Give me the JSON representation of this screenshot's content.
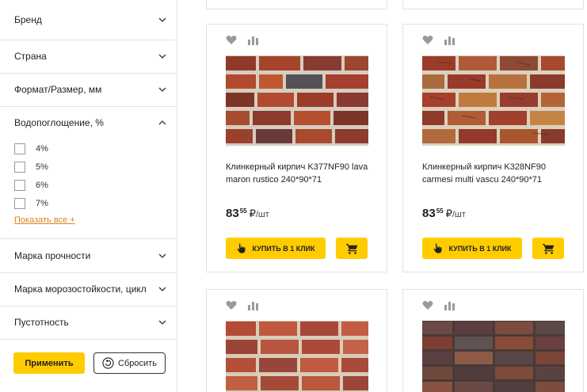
{
  "filters": {
    "sections": [
      {
        "title": "Бренд",
        "icon": "chevron-down-icon"
      },
      {
        "title": "Страна",
        "icon": "chevron-down-icon"
      },
      {
        "title": "Формат/Размер, мм",
        "icon": "chevron-down-icon"
      },
      {
        "title": "Водопоглощение, %",
        "icon": "chevron-up-icon"
      },
      {
        "title": "Марка прочности",
        "icon": "chevron-down-icon"
      },
      {
        "title": "Марка морозостойкости, цикл",
        "icon": "chevron-down-icon"
      },
      {
        "title": "Пустотность",
        "icon": "chevron-down-icon"
      }
    ],
    "water_absorption_options": [
      "4%",
      "5%",
      "6%",
      "7%"
    ],
    "show_all": "Показать все +",
    "apply_label": "Применить",
    "reset_label": "Сбросить"
  },
  "products": [
    {
      "title": "Клинкерный кирпич K377NF90 lava maron rustico 240*90*71",
      "price_int": "83",
      "price_dec": "55",
      "currency": "₽",
      "unit": "/шт",
      "buy_label": "КУПИТЬ В 1 КЛИК"
    },
    {
      "title": "Клинкерный кирпич K328NF90 carmesi multi vascu 240*90*71",
      "price_int": "83",
      "price_dec": "55",
      "currency": "₽",
      "unit": "/шт",
      "buy_label": "КУПИТЬ В 1 КЛИК"
    },
    {
      "title": "",
      "price_int": "",
      "price_dec": "",
      "currency": "",
      "unit": "",
      "buy_label": ""
    },
    {
      "title": "",
      "price_int": "",
      "price_dec": "",
      "currency": "",
      "unit": "",
      "buy_label": ""
    }
  ],
  "colors": {
    "accent": "#ffcc00",
    "link": "#d9861a",
    "border": "#e2e2e2",
    "icon_gray": "#9a9a9a"
  }
}
